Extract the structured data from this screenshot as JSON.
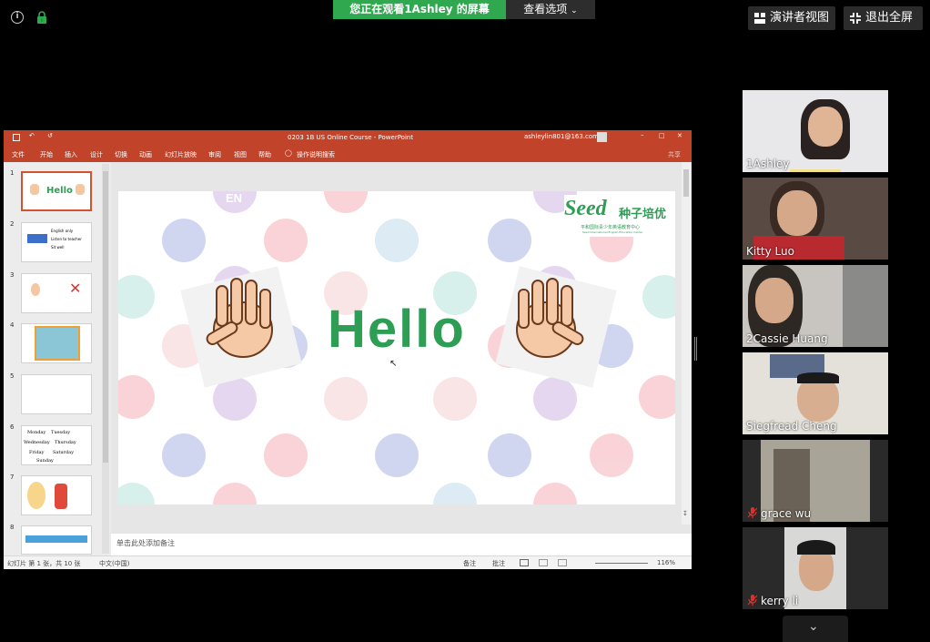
{
  "zoom": {
    "viewing_banner": "您正在观看1Ashley 的屏幕",
    "view_options": "查看选项",
    "presenter_view": "演讲者视图",
    "exit_fullscreen": "退出全屏",
    "info_icon": "i"
  },
  "ppt": {
    "title": "0203 1B US Online Course  -  PowerPoint",
    "account": "ashleylin801@163.com",
    "share": "共享",
    "menu": [
      "文件",
      "开始",
      "插入",
      "设计",
      "切换",
      "动画",
      "幻灯片放映",
      "审阅",
      "视图",
      "帮助"
    ],
    "tell_me": "操作说明搜索",
    "thumb_numbers": [
      "1",
      "2",
      "3",
      "4",
      "5",
      "6",
      "7",
      "8"
    ],
    "thumb1_text": "Hello",
    "thumb2_lines": [
      "English only",
      "Listen to teacher",
      "Sit well"
    ],
    "thumb6_days": [
      "Monday",
      "Tuesday",
      "Wednesday",
      "Thursday",
      "Friday",
      "Saturday",
      "Sunday"
    ],
    "slide": {
      "title": "Hello",
      "logo_text": "Seed",
      "logo_cn": "种子培优",
      "logo_sub": "平和国际青少年英语教育中心",
      "logo_sub2": "Seed International English Education Center",
      "watermark": "EN"
    },
    "notes_placeholder": "单击此处添加备注",
    "status": {
      "slide_counter": "幻灯片 第 1 张，共 10 张",
      "language": "中文(中国)",
      "notes": "备注",
      "comments": "批注",
      "zoom": "116%"
    }
  },
  "participants": [
    {
      "name": "1Ashley",
      "muted": false
    },
    {
      "name": "Kitty Luo",
      "muted": false
    },
    {
      "name": "2Cassie Huang",
      "muted": false
    },
    {
      "name": "Siegfread Cheng",
      "muted": false
    },
    {
      "name": "grace wu",
      "muted": true
    },
    {
      "name": "kerry li",
      "muted": true
    }
  ],
  "colors": {
    "zoom_green": "#2fa84f",
    "ppt_red": "#c0432a",
    "hello_green": "#2e9e55",
    "muted_red": "#e0302a"
  }
}
